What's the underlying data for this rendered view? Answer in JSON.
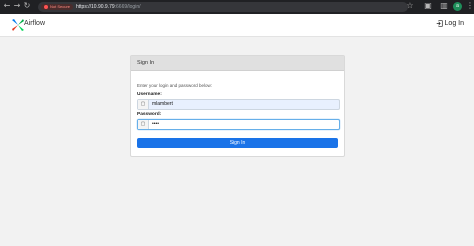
{
  "browser": {
    "security_label": "Not Secure",
    "url_host": "https://10.90.9.79",
    "url_rest": ":6669/login/",
    "profile_initial": "a"
  },
  "navbar": {
    "brand": "Airflow",
    "login_label": "Log In"
  },
  "signin": {
    "title": "Sign In",
    "hint": "Enter your login and password below:",
    "username_label": "Username:",
    "username_value": "mlambert",
    "password_label": "Password:",
    "password_value": "••••",
    "submit_label": "Sign In"
  }
}
